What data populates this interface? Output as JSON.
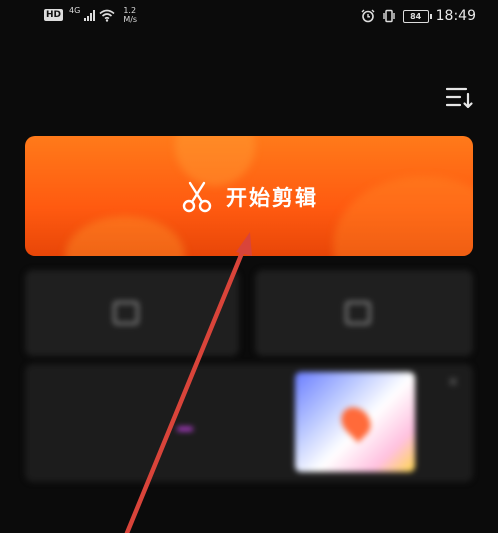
{
  "status_bar": {
    "hd_label": "HD",
    "network_type": "4G",
    "speed_value": "1.2",
    "speed_unit": "M/s",
    "battery_level": "84",
    "time": "18:49"
  },
  "main": {
    "start_edit_label": "开始剪辑"
  },
  "tools": {
    "left_label": "",
    "right_label": ""
  },
  "promo": {
    "title": "",
    "subtitle": "",
    "tag": ""
  },
  "bottom_nav": {
    "item1": "",
    "item2": "",
    "item3": ""
  },
  "colors": {
    "card_orange": "#ff5a10",
    "background": "#0b0b0b",
    "arrow_red": "#d9443a"
  }
}
